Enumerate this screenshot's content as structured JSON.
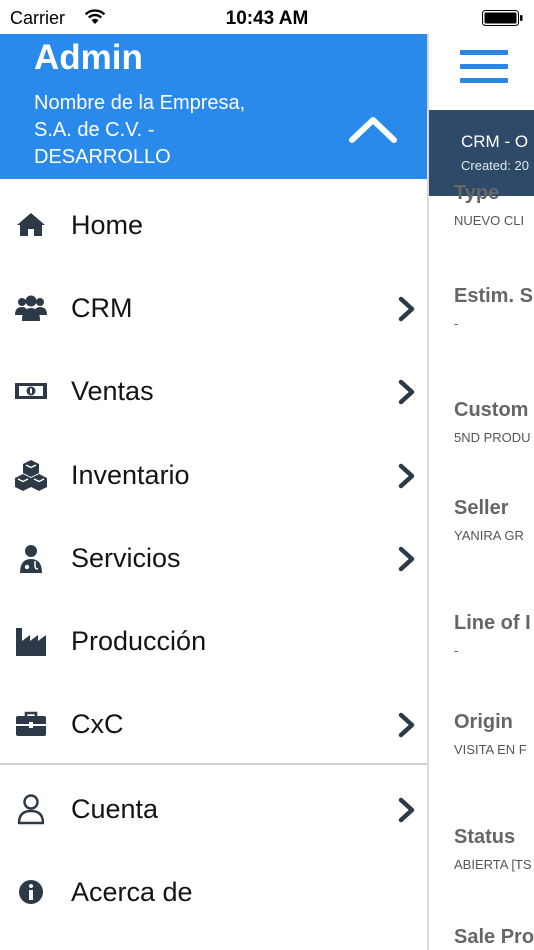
{
  "status_bar": {
    "carrier": "Carrier",
    "time": "10:43 AM"
  },
  "background_screen": {
    "header_title": "CRM - O",
    "header_sub": "Created: 20",
    "fields": [
      {
        "label": "Type",
        "value": "NUEVO CLI"
      },
      {
        "label": "Estim. S",
        "value": "-"
      },
      {
        "label": "Custom",
        "value": "5ND PRODU"
      },
      {
        "label": "Seller",
        "value": "YANIRA GR"
      },
      {
        "label": "Line of I",
        "value": "-"
      },
      {
        "label": "Origin",
        "value": "VISITA EN F"
      },
      {
        "label": "Status",
        "value": "ABIERTA [TS"
      },
      {
        "label": "Sale Pro",
        "value": ""
      }
    ]
  },
  "drawer": {
    "user": "Admin",
    "company_lines": [
      "Nombre de la Empresa,",
      "S.A. de C.V. -",
      "DESARROLLO"
    ],
    "menu": [
      {
        "label": "Home",
        "icon": "home-icon",
        "has_chevron": false
      },
      {
        "label": "CRM",
        "icon": "users-icon",
        "has_chevron": true
      },
      {
        "label": "Ventas",
        "icon": "money-icon",
        "has_chevron": true
      },
      {
        "label": "Inventario",
        "icon": "cubes-icon",
        "has_chevron": true
      },
      {
        "label": "Servicios",
        "icon": "user-md-icon",
        "has_chevron": true
      },
      {
        "label": "Producción",
        "icon": "industry-icon",
        "has_chevron": false
      },
      {
        "label": "CxC",
        "icon": "briefcase-icon",
        "has_chevron": true
      },
      {
        "label": "Cuenta",
        "icon": "user-outline-icon",
        "has_chevron": true
      },
      {
        "label": "Acerca de",
        "icon": "info-icon",
        "has_chevron": false
      }
    ]
  },
  "colors": {
    "drawer_header": "#2a8aec",
    "background_header": "#2f4a68",
    "icon": "#2b3a46"
  }
}
